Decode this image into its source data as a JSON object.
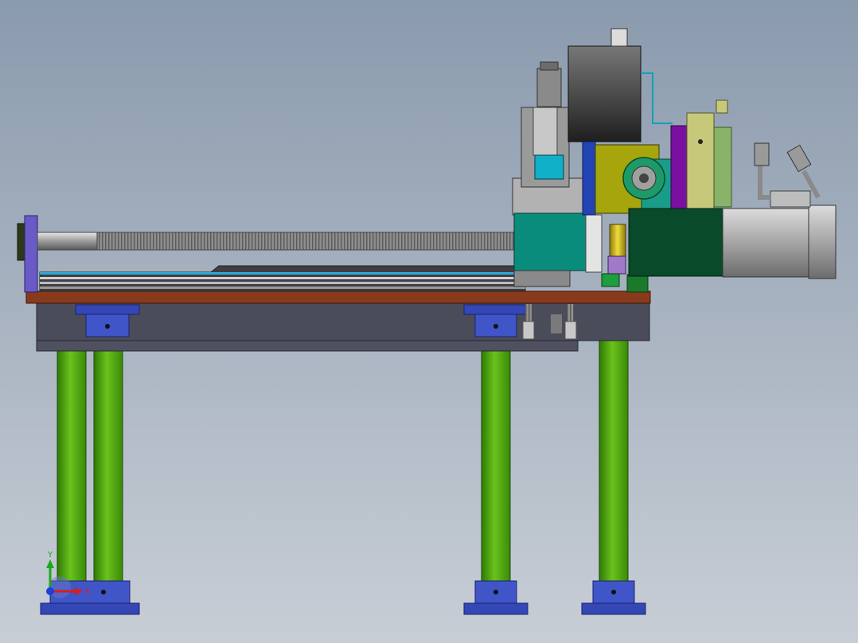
{
  "viewport": {
    "background_top": "#8a9aad",
    "background_bottom": "#c8ced6"
  },
  "triad": {
    "y_label": "Y",
    "x_label": "X",
    "y_color": "#1fa81f",
    "x_color": "#d81e1e",
    "z_color": "#1e3fd8"
  },
  "colors": {
    "leg_green": "#4fa80e",
    "foot_blue": "#3447b4",
    "plate_rust": "#8a3a1c",
    "frame_gray": "#4a4c5a",
    "slider_teal": "#0a8c7c",
    "bracket_olive": "#a6a60c",
    "dark_green": "#084a2a",
    "motor_gray": "#a8a8a8",
    "purple": "#7a10a0",
    "tan": "#c8c87a"
  }
}
